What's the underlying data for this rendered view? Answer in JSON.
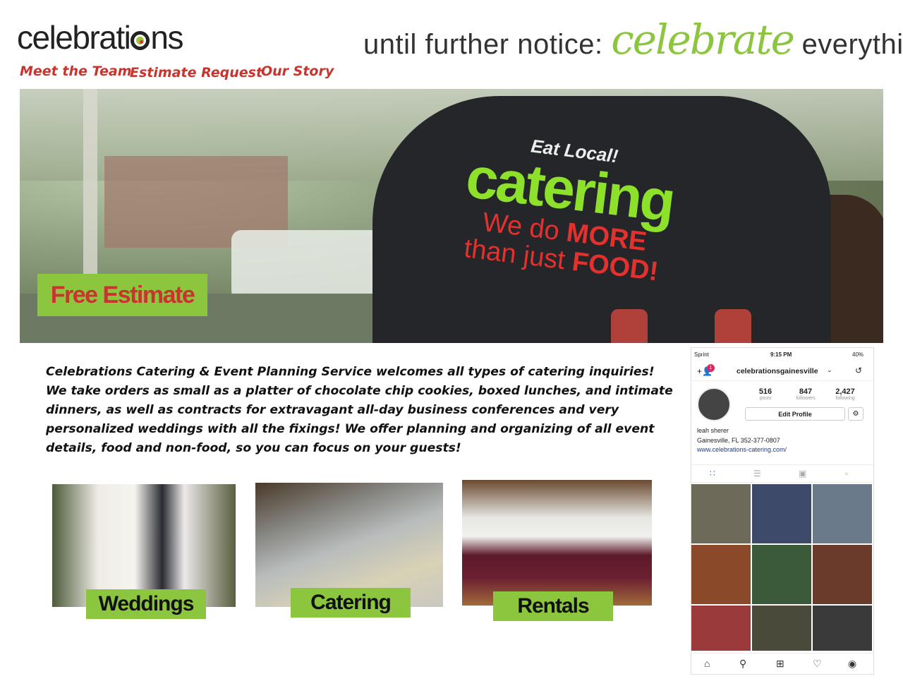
{
  "header": {
    "brand": "celebrations",
    "tagline_pre": "until further notice:",
    "tagline_highlight": "celebrate",
    "tagline_post": "everything"
  },
  "nav": [
    {
      "label": "Meet the Team"
    },
    {
      "label": "Estimate Request"
    },
    {
      "label": "Our Story"
    }
  ],
  "hero": {
    "shirt_line1": "Eat Local!",
    "shirt_line2": "catering",
    "shirt_line3a": "We do",
    "shirt_line3b": "MORE",
    "shirt_line4a": "than just",
    "shirt_line4b": "FOOD!",
    "cta_label": "Free Estimate"
  },
  "intro_text": "Celebrations Catering & Event Planning Service welcomes all types of catering inquiries!  We take orders as small as a platter of chocolate chip cookies, boxed lunches, and intimate dinners, as well as contracts for extravagant all-day business conferences and  very personalized weddings with all the fixings!  We offer planning and organizing of all event details, food and non-food,  so you can focus on your guests!",
  "tiles": [
    {
      "label": "Weddings"
    },
    {
      "label": "Catering"
    },
    {
      "label": "Rentals"
    }
  ],
  "instagram": {
    "carrier": "Sprint",
    "time": "9:15 PM",
    "battery": "40%",
    "notification_count": "1",
    "username": "celebrationsgainesville",
    "stats": [
      {
        "value": "516",
        "label": "posts"
      },
      {
        "value": "847",
        "label": "followers"
      },
      {
        "value": "2,427",
        "label": "following"
      }
    ],
    "edit_profile_label": "Edit Profile",
    "name": "leah sherer",
    "location": "Gainesville, FL 352-377-0807",
    "website": "www.celebrations-catering.com/",
    "grid_colors": [
      "#6d6a5a",
      "#3d4a6a",
      "#6a7a8a",
      "#8a4a2a",
      "#3a5a3a",
      "#6a3a2a",
      "#9a3a3a",
      "#4a4a3a",
      "#3a3a3a"
    ]
  },
  "colors": {
    "brand_green": "#8cc63f",
    "brand_red": "#c8352f"
  }
}
